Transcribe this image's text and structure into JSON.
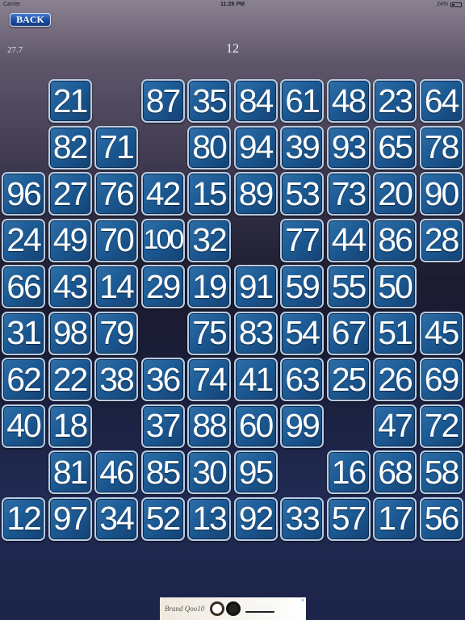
{
  "status": {
    "carrier": "Carrier",
    "time": "11:26 PM",
    "battery": "24%"
  },
  "header": {
    "back_label": "BACK",
    "timer": "27.7",
    "target": "12"
  },
  "board": {
    "columns": 10,
    "rows": [
      [
        null,
        21,
        null,
        87,
        35,
        84,
        61,
        48,
        23,
        64
      ],
      [
        null,
        82,
        71,
        null,
        80,
        94,
        39,
        93,
        65,
        78
      ],
      [
        96,
        27,
        76,
        42,
        15,
        89,
        53,
        73,
        20,
        90
      ],
      [
        24,
        49,
        70,
        100,
        32,
        null,
        77,
        44,
        86,
        28
      ],
      [
        66,
        43,
        14,
        29,
        19,
        91,
        59,
        55,
        50,
        null
      ],
      [
        31,
        98,
        79,
        null,
        75,
        83,
        54,
        67,
        51,
        45
      ],
      [
        62,
        22,
        38,
        36,
        74,
        41,
        63,
        25,
        26,
        69
      ],
      [
        40,
        18,
        null,
        37,
        88,
        60,
        99,
        null,
        47,
        72
      ],
      [
        null,
        81,
        46,
        85,
        30,
        95,
        null,
        16,
        68,
        58
      ],
      [
        12,
        97,
        34,
        52,
        13,
        92,
        33,
        57,
        17,
        56
      ]
    ]
  },
  "ad": {
    "brand": "Brand Qoo10",
    "close_label": "×"
  },
  "icons": {
    "wifi": "wifi-icon",
    "battery": "battery-icon"
  }
}
